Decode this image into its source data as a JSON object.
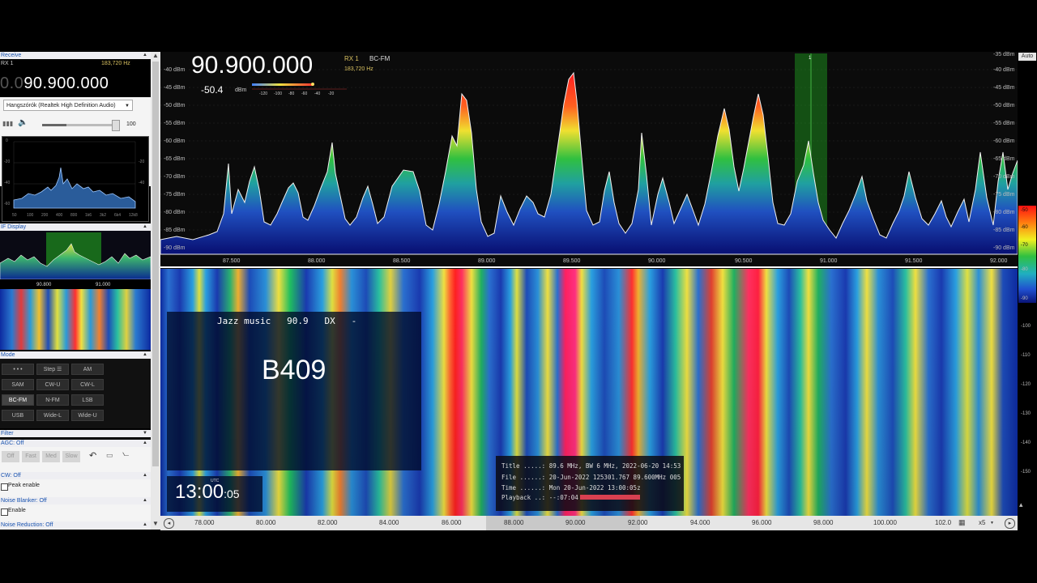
{
  "left_panel": {
    "section_receive": "Receive",
    "rx_label": "RX 1",
    "rx_hz": "183,720 Hz",
    "frequency_dim": "0.0",
    "frequency": "90.900.000",
    "audio_device": "Hangszórók (Realtek High Definition Audio)",
    "volume": "100",
    "mini_spec_db": [
      "0",
      "-20",
      "-40",
      "-60"
    ],
    "mini_spec_freqs": [
      "50",
      "100",
      "200",
      "400",
      "800",
      "1k6",
      "3k2",
      "6k4",
      "12k8"
    ],
    "if_display_title": "IF Display",
    "if_freqs": [
      "90.800",
      "91.000"
    ],
    "mode_title": "Mode",
    "modes": [
      "• • •",
      "Step ☰",
      "AM",
      "SAM",
      "CW-U",
      "CW-L",
      "BC-FM",
      "N-FM",
      "LSB",
      "USB",
      "Wide-L",
      "Wide-U"
    ],
    "filter_title": "Filter",
    "agc_title": "AGC: Off",
    "agc_buttons": [
      "Off",
      "Fast",
      "Med",
      "Slow"
    ],
    "cw_title": "CW: Off",
    "peak_enable": "Peak enable",
    "nb_title": "Noise Blanker: Off",
    "nb_enable": "Enable",
    "nr_title": "Noise Reduction: Off"
  },
  "spectrum": {
    "frequency": "90.900.000",
    "rx": "RX 1",
    "mode": "BC-FM",
    "offset_hz": "183,720 Hz",
    "level": "-50.4",
    "level_unit": "dBm",
    "meter_scale": [
      "-120",
      "-100",
      "-80",
      "-60",
      "-40",
      "-20"
    ],
    "db_labels": [
      "-35 dBm",
      "-40 dBm",
      "-45 dBm",
      "-50 dBm",
      "-55 dBm",
      "-60 dBm",
      "-65 dBm",
      "-70 dBm",
      "-75 dBm",
      "-80 dBm",
      "-85 dBm",
      "-90 dBm"
    ],
    "freq_labels": [
      "87.500",
      "88.000",
      "88.500",
      "89.000",
      "89.500",
      "90.000",
      "90.500",
      "91.000",
      "91.500",
      "92.000"
    ],
    "marker": "1"
  },
  "waterfall": {
    "rds_line": "Jazz music   90.9   DX   -",
    "ps": "B409",
    "utc_label": "UTC",
    "time_main": "13:00",
    "time_sec": ":05",
    "info": [
      "Title .....: 89.6 MHz, BW 6 MHz, 2022-06-20 14:53",
      "File ......: 20-Jun-2022 125301.767 89.600MHz 005",
      "Time ......: Mon 20-Jun-2022 13:00:05z",
      "Playback ..: --:07:04"
    ]
  },
  "bottom_bar": {
    "freqs": [
      "78.000",
      "80.000",
      "82.000",
      "84.000",
      "86.000",
      "88.000",
      "90.000",
      "92.000",
      "94.000",
      "96.000",
      "98.000",
      "100.000",
      "102.0"
    ],
    "zoom": "x5"
  },
  "right_bar": {
    "auto": "Auto",
    "labels": [
      "-50",
      "-60",
      "-70",
      "-80",
      "-90",
      "-100",
      "-110",
      "-120",
      "-130",
      "-140",
      "-150"
    ]
  },
  "colors": {
    "accent_blue": "#1a54b0",
    "selection_green": "#1e8a1e",
    "background": "#000000"
  }
}
